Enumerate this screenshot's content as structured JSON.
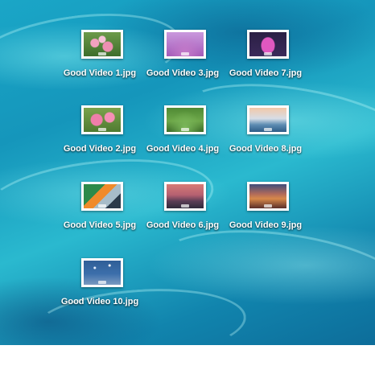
{
  "desktop": {
    "files": [
      {
        "name": "Good Video 1.jpg",
        "thumb": "pink-flowers"
      },
      {
        "name": "Good Video 3.jpg",
        "thumb": "lavender"
      },
      {
        "name": "Good Video 7.jpg",
        "thumb": "lotus"
      },
      {
        "name": "Good Video 2.jpg",
        "thumb": "camellia"
      },
      {
        "name": "Good Video 4.jpg",
        "thumb": "green-field"
      },
      {
        "name": "Good Video 8.jpg",
        "thumb": "sea-cliff"
      },
      {
        "name": "Good Video 5.jpg",
        "thumb": "abstract"
      },
      {
        "name": "Good Video 6.jpg",
        "thumb": "mountain-dusk"
      },
      {
        "name": "Good Video 9.jpg",
        "thumb": "mountain-sunset"
      },
      {
        "name": "Good Video 10.jpg",
        "thumb": "night-sky"
      }
    ]
  },
  "colors": {
    "wallpaper_primary": "#1596bb",
    "wallpaper_highlight": "#2ab9cf",
    "label_text": "#ffffff"
  }
}
